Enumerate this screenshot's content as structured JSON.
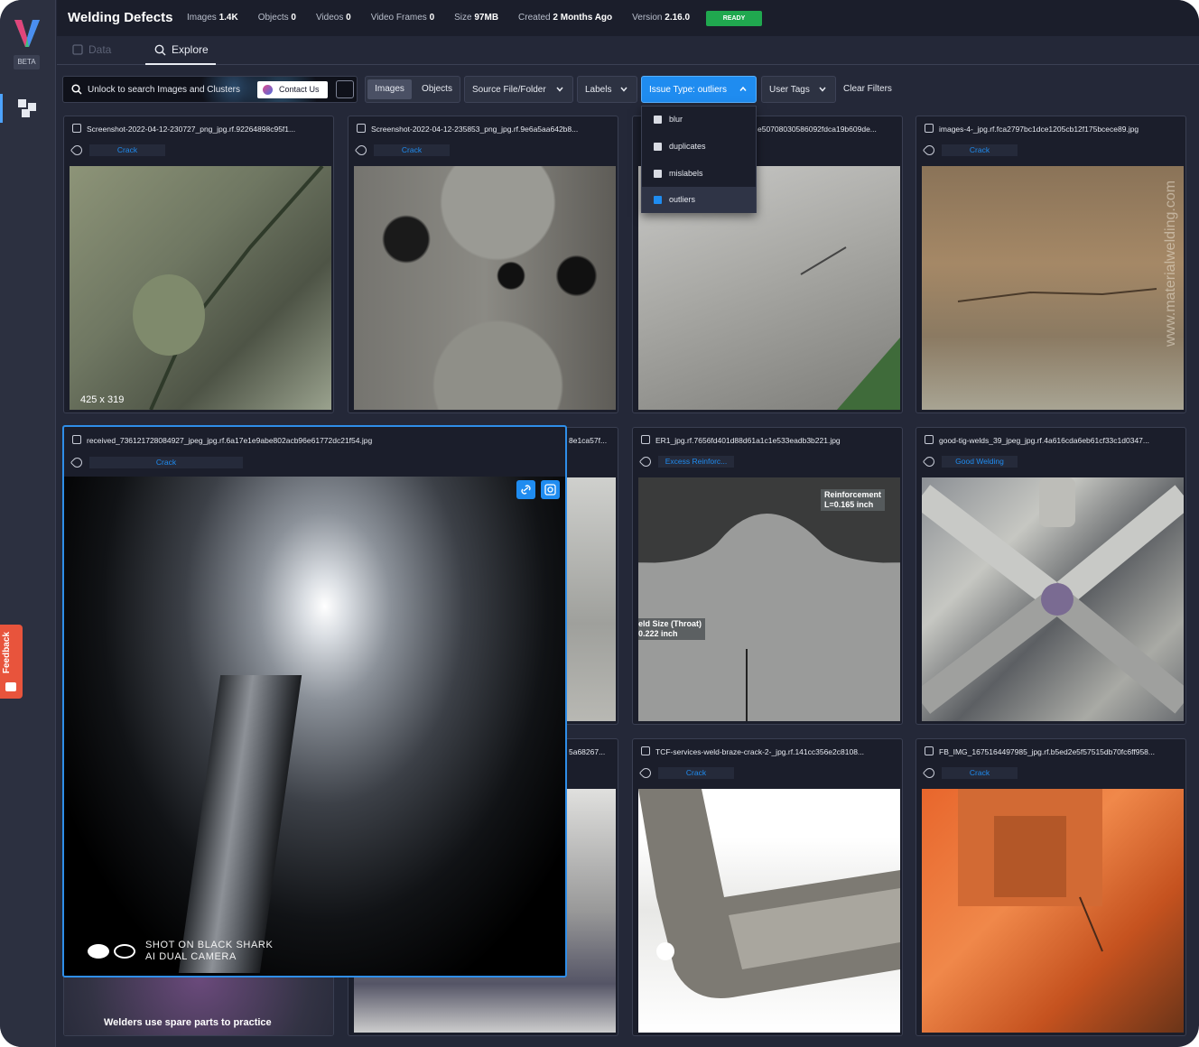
{
  "app": {
    "beta_label": "BETA",
    "feedback_label": "Feedback"
  },
  "header": {
    "title": "Welding Defects",
    "stats": [
      {
        "label": "Images",
        "value": "1.4K"
      },
      {
        "label": "Objects",
        "value": "0"
      },
      {
        "label": "Videos",
        "value": "0"
      },
      {
        "label": "Video Frames",
        "value": "0"
      },
      {
        "label": "Size",
        "value": "97MB"
      },
      {
        "label": "Created",
        "value": "2 Months Ago"
      },
      {
        "label": "Version",
        "value": "2.16.0"
      }
    ],
    "status": "READY"
  },
  "tabs": [
    {
      "label": "Data"
    },
    {
      "label": "Explore"
    }
  ],
  "toolbar": {
    "search_text": "Unlock to search Images and Clusters",
    "contact_label": "Contact Us",
    "seg_images": "Images",
    "seg_objects": "Objects",
    "source_label": "Source File/Folder",
    "labels_label": "Labels",
    "issue_label": "Issue Type: outliers",
    "user_tags_label": "User Tags",
    "clear_filters": "Clear Filters"
  },
  "issue_menu": [
    {
      "label": "blur",
      "checked": false
    },
    {
      "label": "duplicates",
      "checked": false
    },
    {
      "label": "mislabels",
      "checked": false
    },
    {
      "label": "outliers",
      "checked": true
    }
  ],
  "cards": [
    {
      "file": "Screenshot-2022-04-12-230727_png_jpg.rf.92264898c95f1...",
      "label": "Crack",
      "dims": "425 x 319"
    },
    {
      "file": "Screenshot-2022-04-12-235853_png_jpg.rf.9e6a5aa642b8...",
      "label": "Crack"
    },
    {
      "file": "e50708030586092fdca19b609de...",
      "label": ""
    },
    {
      "file": "images-4-_jpg.rf.fca2797bc1dce1205cb12f175bcece89.jpg",
      "label": "Crack"
    },
    {
      "file": "8e1ca57f...",
      "label": ""
    },
    {
      "file": "ER1_jpg.rf.7656fd401d88d61a1c1e533eadb3b221.jpg",
      "label": "Excess Reinforc...",
      "overlay1": "Reinforcement\nL=0.165 inch",
      "overlay2": "eld Size (Throat)\n0.222 inch"
    },
    {
      "file": "good-tig-welds_39_jpeg_jpg.rf.4a616cda6eb61cf33c1d0347...",
      "label": "Good Welding"
    },
    {
      "file": "5a68267...",
      "label": ""
    },
    {
      "file": "TCF-services-weld-braze-crack-2-_jpg.rf.141cc356e2c8108...",
      "label": "Crack"
    },
    {
      "file": "FB_IMG_1675164497985_jpg.rf.b5ed2e5f57515db70fc6ff958...",
      "label": "Crack"
    },
    {
      "caption": "Welders use spare parts to practice"
    }
  ],
  "expanded": {
    "file": "received_736121728084927_jpeg_jpg.rf.6a17e1e9abe802acb96e61772dc21f54.jpg",
    "label": "Crack",
    "camera_line1": "SHOT ON BLACK SHARK",
    "camera_line2": "AI DUAL CAMERA"
  },
  "watermark": "www.materialwelding.com"
}
